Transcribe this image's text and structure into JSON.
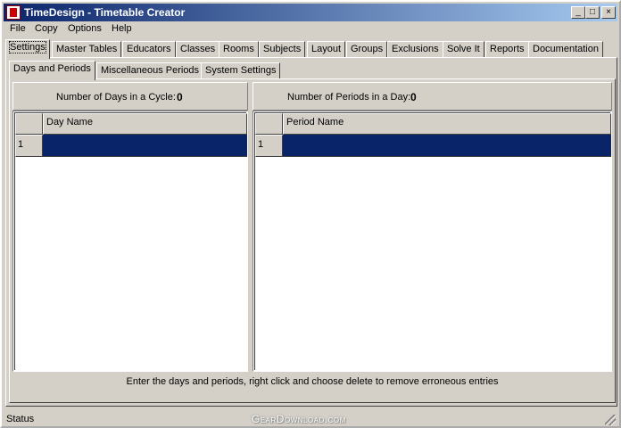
{
  "window": {
    "title": "TimeDesign - Timetable Creator",
    "controls": {
      "minimize": "_",
      "maximize": "□",
      "close": "×"
    }
  },
  "menu": [
    "File",
    "Copy",
    "Options",
    "Help"
  ],
  "main_tabs": [
    "Settings",
    "Master Tables",
    "Educators",
    "Classes",
    "Rooms",
    "Subjects",
    "Layout",
    "Groups",
    "Exclusions",
    "Solve It",
    "Reports",
    "Documentation"
  ],
  "active_main_tab": "Settings",
  "sub_tabs": [
    "Days and Periods",
    "Miscellaneous Periods",
    "System Settings"
  ],
  "active_sub_tab": "Days and Periods",
  "days": {
    "label": "Number of Days in a Cycle:",
    "count": "0",
    "column_header": "Day Name",
    "rows": [
      {
        "index": "1",
        "name": ""
      }
    ]
  },
  "periods": {
    "label": "Number of Periods in a Day:",
    "count": "0",
    "column_header": "Period Name",
    "rows": [
      {
        "index": "1",
        "name": ""
      }
    ]
  },
  "hint": "Enter the days and periods, right click and choose delete to remove erroneous entries",
  "status": "Status",
  "watermark": "GearDownload.com",
  "colors": {
    "selection": "#0a246a",
    "titlebar": "#0a246a",
    "face": "#d4d0c8"
  }
}
